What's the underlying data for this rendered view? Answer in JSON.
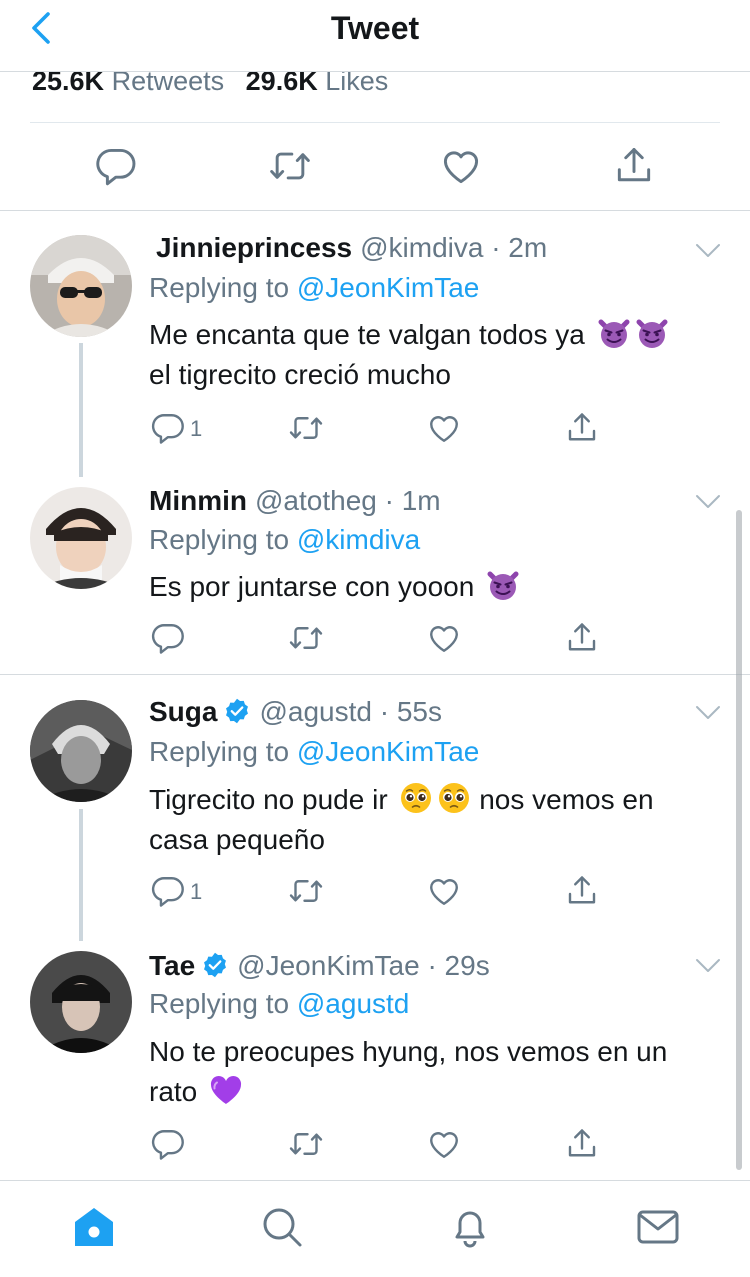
{
  "header": {
    "title": "Tweet"
  },
  "stats": {
    "retweets_count": "25.6K",
    "retweets_label": "Retweets",
    "likes_count": "29.6K",
    "likes_label": "Likes"
  },
  "colors": {
    "accent": "#1da1f2",
    "secondary_text": "#657786",
    "divider": "#d6dbdf",
    "devil_emoji": "#8e44ad",
    "heart_emoji": "#a23ee8"
  },
  "replies": [
    {
      "name": "Jinnieprincess",
      "handle": "@kimdiva · 2m",
      "replying_label": "Replying to",
      "replying_to": "@JeonKimTae",
      "text": "Me encanta que te valgan todos ya",
      "text2": "el tigrecito creció mucho",
      "emojis": [
        "smiling-imp",
        "smiling-imp"
      ],
      "reply_count": "1"
    },
    {
      "name": "Minmin",
      "handle": "@atotheg · 1m",
      "replying_label": "Replying to",
      "replying_to": "@kimdiva",
      "text": "Es por juntarse con yooon",
      "emojis": [
        "smiling-imp"
      ],
      "reply_count": ""
    },
    {
      "name": "Suga",
      "verified": true,
      "handle": "@agustd · 55s",
      "replying_label": "Replying to",
      "replying_to": "@JeonKimTae",
      "text": "Tigrecito no pude ir",
      "text_after": "nos vemos en",
      "text2": "casa pequeño",
      "emojis": [
        "pleading-face",
        "pleading-face"
      ],
      "reply_count": "1"
    },
    {
      "name": "Tae",
      "verified": true,
      "handle": "@JeonKimTae · 29s",
      "replying_label": "Replying to",
      "replying_to": "@agustd",
      "text": "No te preocupes hyung, nos vemos en un",
      "text2": "rato",
      "emojis": [
        "purple-heart"
      ],
      "reply_count": ""
    }
  ],
  "tabs": [
    {
      "icon": "home-icon"
    },
    {
      "icon": "search-icon"
    },
    {
      "icon": "notifications-icon"
    },
    {
      "icon": "messages-icon"
    }
  ]
}
